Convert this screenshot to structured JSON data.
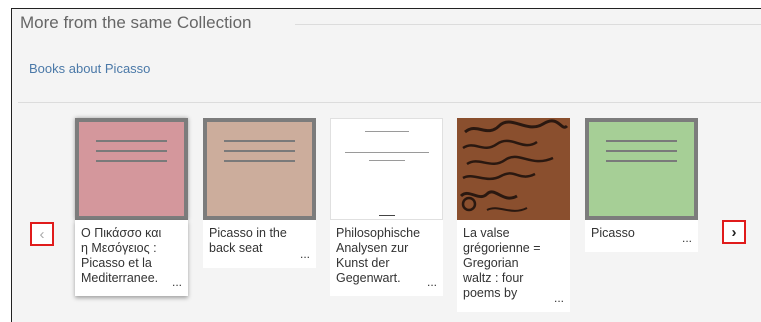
{
  "section": {
    "title": "More from the same Collection",
    "collection_link": "Books about Picasso"
  },
  "nav": {
    "prev_icon": "chevron-left-icon",
    "prev_glyph": "‹",
    "next_icon": "chevron-right-icon",
    "next_glyph": "›"
  },
  "items": [
    {
      "title": "Ο Πικάσσο και η Μεσόγειος : Picasso et la Mediterranee.",
      "cover": "book",
      "cover_color": "#d4979c",
      "more": "..."
    },
    {
      "title": "Picasso in the back seat",
      "cover": "book",
      "cover_color": "#ccad9c",
      "more": "..."
    },
    {
      "title": "Philosophische Analysen zur Kunst der Gegenwart.",
      "cover": "doc",
      "cover_color": "#ffffff",
      "more": "..."
    },
    {
      "title": "La valse grégorienne = Gregorian waltz : four poems by",
      "cover": "art",
      "cover_color": "#8a4f2e",
      "more": "..."
    },
    {
      "title": "Picasso",
      "cover": "book",
      "cover_color": "#a6cf96",
      "more": "..."
    }
  ]
}
